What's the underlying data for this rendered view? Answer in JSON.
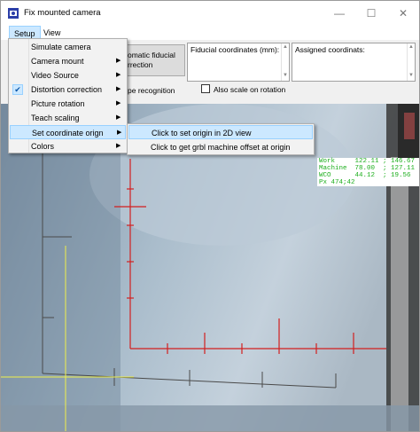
{
  "window": {
    "title": "Fix mounted camera",
    "minimize_glyph": "—",
    "maximize_glyph": "☐",
    "close_glyph": "✕"
  },
  "menubar": {
    "items": [
      {
        "label": "Setup"
      },
      {
        "label": "View"
      }
    ]
  },
  "toolbar": {
    "fiducial_button_line1": "omatic fiducial",
    "fiducial_button_line2": "rrection",
    "fiducial_coords_label": "Fiducial coordinates (mm):",
    "assigned_coords_label": "Assigned coordinats:",
    "shape_recognition_label": "pe recognition",
    "scale_on_rotation_label": "Also scale on rotation",
    "scale_on_rotation_checked": false
  },
  "setup_menu": {
    "items": [
      {
        "label": "Simulate camera",
        "submenu": false,
        "checked": false
      },
      {
        "label": "Camera mount",
        "submenu": true,
        "checked": false
      },
      {
        "label": "Video Source",
        "submenu": true,
        "checked": false
      },
      {
        "label": "Distortion correction",
        "submenu": true,
        "checked": true
      },
      {
        "label": "Picture rotation",
        "submenu": true,
        "checked": false
      },
      {
        "label": "Teach scaling",
        "submenu": true,
        "checked": false
      },
      {
        "label": "Set coordinate orign",
        "submenu": true,
        "checked": false,
        "highlighted": true
      },
      {
        "label": "Colors",
        "submenu": true,
        "checked": false
      }
    ],
    "submenu_arrow": "▶",
    "check_glyph": "✔"
  },
  "coordinate_submenu": {
    "items": [
      {
        "label": "Click to set origin in 2D view",
        "highlighted": true
      },
      {
        "label": "Click to get grbl machine offset at origin",
        "highlighted": false
      }
    ]
  },
  "readout": {
    "work": "Work     122.11 ; 146.67",
    "machine": "Machine  78.00  ; 127.11",
    "wco": "WCO      44.12  ; 19.56",
    "px": "Px 474;42"
  },
  "colors": {
    "accent_highlight": "#cce8ff",
    "readout_text": "#1cae1c",
    "grid_axis": "#d21f1f",
    "crosshair": "#f0f04a"
  }
}
